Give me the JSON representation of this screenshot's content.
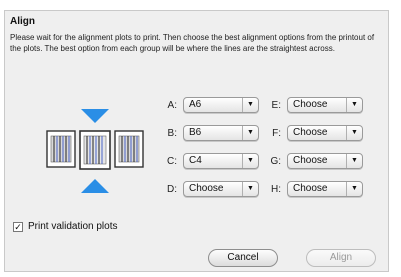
{
  "dialog": {
    "title": "Align",
    "instructions": "Please wait for the alignment plots to print. Then choose the best alignment options from the printout of the plots. The best option from each group will be where the lines are the straightest across."
  },
  "selectors": {
    "left": [
      {
        "label": "A:",
        "value": "A6"
      },
      {
        "label": "B:",
        "value": "B6"
      },
      {
        "label": "C:",
        "value": "C4"
      },
      {
        "label": "D:",
        "value": "Choose"
      }
    ],
    "right": [
      {
        "label": "E:",
        "value": "Choose"
      },
      {
        "label": "F:",
        "value": "Choose"
      },
      {
        "label": "G:",
        "value": "Choose"
      },
      {
        "label": "H:",
        "value": "Choose"
      }
    ]
  },
  "checkbox": {
    "label": "Print validation plots",
    "checked": true,
    "mark": "✓"
  },
  "buttons": {
    "cancel": "Cancel",
    "align": "Align"
  },
  "colors": {
    "arrow": "#2a8ee6",
    "dialog_bg": "#efefef"
  },
  "icons": {
    "plot_graphic": "alignment-plots-icon",
    "popup_arrow": "▼"
  }
}
